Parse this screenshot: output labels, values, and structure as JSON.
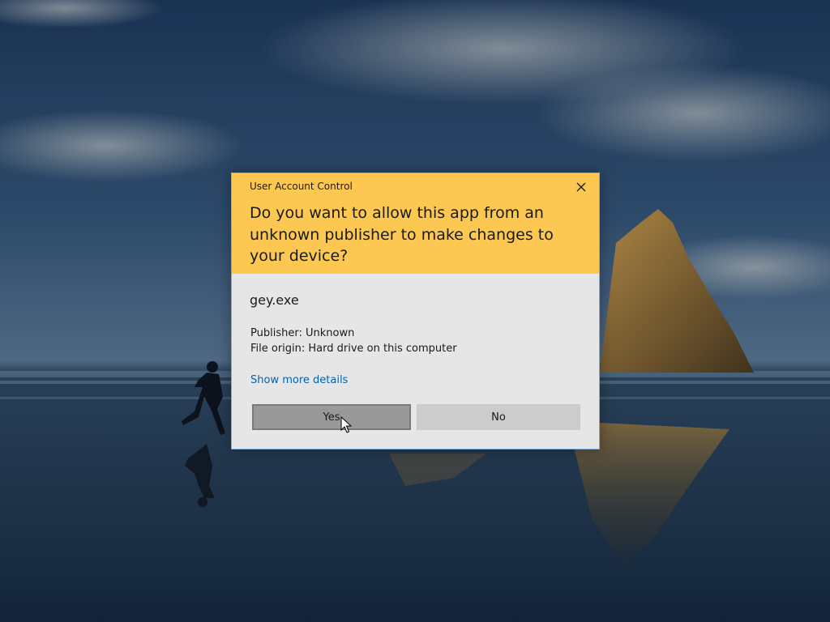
{
  "dialog": {
    "title": "User Account Control",
    "question": "Do you want to allow this app from an unknown publisher to make changes to your device?",
    "app_name": "gey.exe",
    "publisher": "Publisher: Unknown",
    "file_origin": "File origin: Hard drive on this computer",
    "details_link": "Show more details",
    "yes_label": "Yes",
    "no_label": "No",
    "close_icon": "close-icon"
  },
  "colors": {
    "header": "#fcc852",
    "body": "#e6e6e6",
    "link": "#0063b1",
    "yes_button": "#999999",
    "no_button": "#cccccc",
    "border": "#7fa9d6"
  }
}
